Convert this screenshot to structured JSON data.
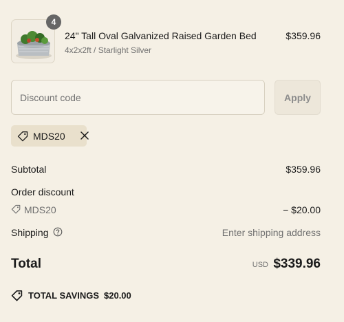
{
  "line_item": {
    "quantity": "4",
    "title": "24\" Tall Oval Galvanized Raised Garden Bed",
    "variant": "4x2x2ft / Starlight Silver",
    "price": "$359.96"
  },
  "discount": {
    "placeholder": "Discount code",
    "value": "",
    "apply_label": "Apply",
    "applied_code": "MDS20"
  },
  "summary": {
    "subtotal_label": "Subtotal",
    "subtotal_value": "$359.96",
    "order_discount_label": "Order discount",
    "order_discount_code": "MDS20",
    "order_discount_value": "− $20.00",
    "shipping_label": "Shipping",
    "shipping_value": "Enter shipping address",
    "total_label": "Total",
    "total_currency": "USD",
    "total_value": "$339.96",
    "savings_label": "TOTAL SAVINGS",
    "savings_value": "$20.00"
  },
  "icons": {
    "tag": "tag-icon",
    "close": "close-icon",
    "help": "help-circle-icon"
  },
  "colors": {
    "background": "#f5f0e5",
    "chip": "#e9e0cc",
    "badge": "#666666",
    "muted_text": "#707070"
  }
}
